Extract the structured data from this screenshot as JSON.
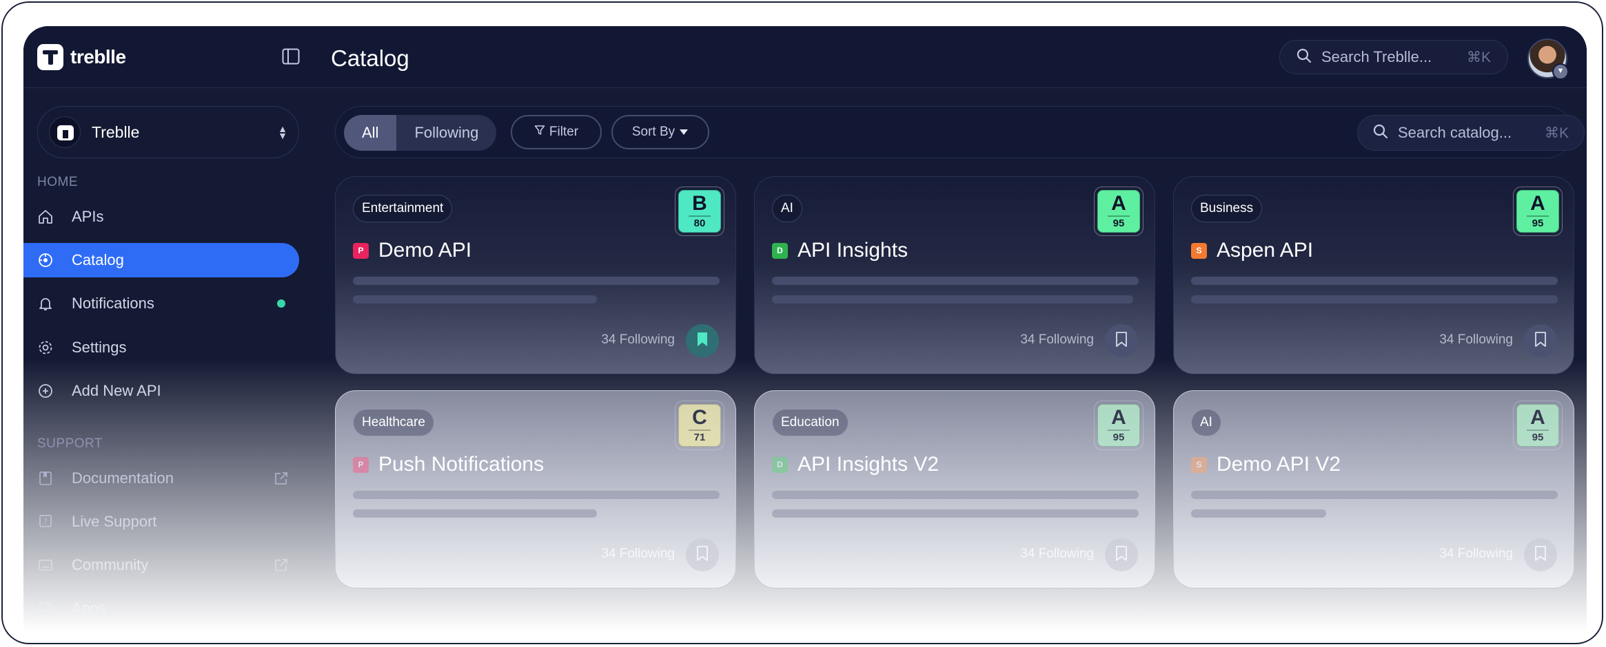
{
  "topbar": {
    "logo_text": "treblle",
    "page_title": "Catalog",
    "search_placeholder": "Search Treblle...",
    "search_shortcut": "⌘K"
  },
  "sidebar": {
    "workspace_name": "Treblle",
    "home_label": "HOME",
    "support_label": "SUPPORT",
    "home_items": [
      {
        "label": "APIs",
        "icon": "home-icon"
      },
      {
        "label": "Catalog",
        "icon": "catalog-icon",
        "active": true
      },
      {
        "label": "Notifications",
        "icon": "bell-icon",
        "dot": true
      },
      {
        "label": "Settings",
        "icon": "gear-icon"
      },
      {
        "label": "Add New API",
        "icon": "plus-circle-icon"
      }
    ],
    "support_items": [
      {
        "label": "Documentation",
        "icon": "book-icon",
        "external": true
      },
      {
        "label": "Live Support",
        "icon": "help-icon"
      },
      {
        "label": "Community",
        "icon": "community-icon",
        "external": true
      },
      {
        "label": "Apps",
        "icon": "apps-icon"
      }
    ]
  },
  "toolbar": {
    "tab_all": "All",
    "tab_following": "Following",
    "filter_label": "Filter",
    "sort_label": "Sort By",
    "search_placeholder": "Search catalog...",
    "search_shortcut": "⌘K"
  },
  "cards": [
    {
      "category": "Entertainment",
      "grade": "B",
      "score": "80",
      "plan": "P",
      "plan_color": "#e8245f",
      "title": "Demo API",
      "following": "34 Following",
      "bookmarked": true,
      "grade_color": "#4ee8c3"
    },
    {
      "category": "AI",
      "grade": "A",
      "score": "95",
      "plan": "D",
      "plan_color": "#2fb34f",
      "title": "API Insights",
      "following": "34 Following",
      "bookmarked": false,
      "grade_color": "#5ef0a0"
    },
    {
      "category": "Business",
      "grade": "A",
      "score": "95",
      "plan": "S",
      "plan_color": "#f47a32",
      "title": "Aspen API",
      "following": "34 Following",
      "bookmarked": false,
      "grade_color": "#5ef0a0"
    },
    {
      "category": "Healthcare",
      "grade": "C",
      "score": "71",
      "plan": "P",
      "plan_color": "#f06b96",
      "title": "Push Notifications",
      "following": "34 Following",
      "bookmarked": false,
      "grade_color": "#f9f3b0"
    },
    {
      "category": "Education",
      "grade": "A",
      "score": "95",
      "plan": "D",
      "plan_color": "#6fd48c",
      "title": "API Insights V2",
      "following": "34 Following",
      "bookmarked": false,
      "grade_color": "#b9f5cf"
    },
    {
      "category": "AI",
      "grade": "A",
      "score": "95",
      "plan": "S",
      "plan_color": "#f5ab7c",
      "title": "Demo API V2",
      "following": "34 Following",
      "bookmarked": false,
      "grade_color": "#b9f5cf"
    }
  ]
}
